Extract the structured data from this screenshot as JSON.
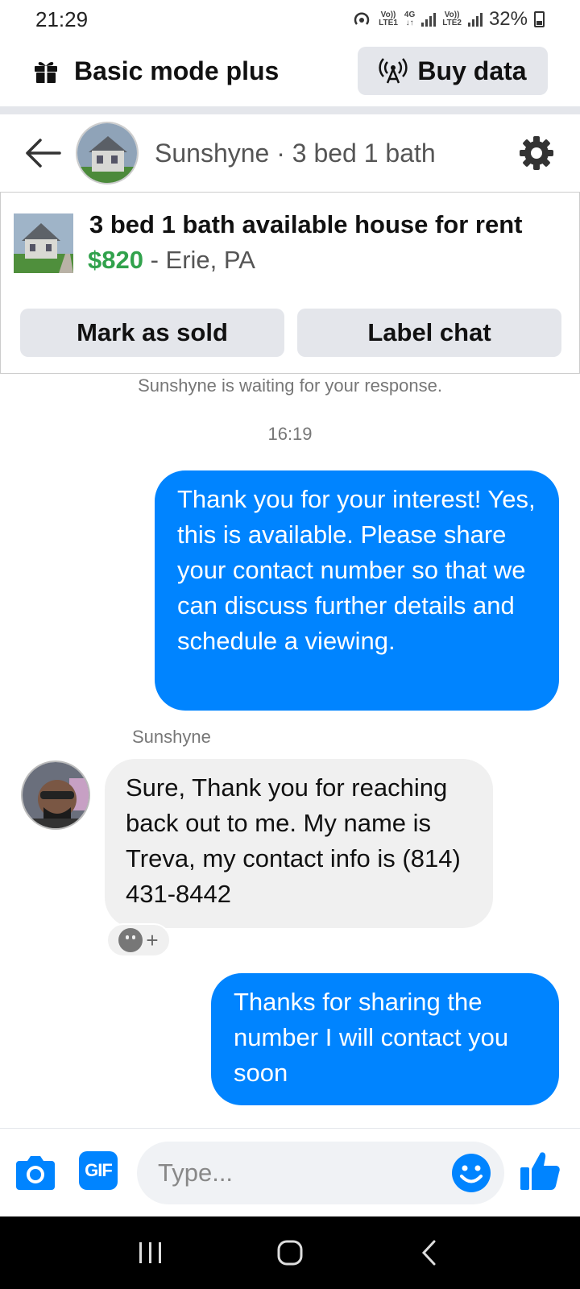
{
  "status": {
    "time": "21:29",
    "sim1": {
      "top": "Vo))",
      "bottom": "LTE1"
    },
    "network": {
      "top": "4G",
      "bottom": "↓↑"
    },
    "sim2": {
      "top": "Vo))",
      "bottom": "LTE2"
    },
    "battery": "32%"
  },
  "mode_bar": {
    "title": "Basic mode plus",
    "buy_data_label": "Buy data"
  },
  "chat_header": {
    "title": "Sunshyne · 3 bed 1 bath"
  },
  "listing": {
    "title": "3 bed 1 bath available house for rent",
    "price": "$820",
    "location": " - Erie, PA",
    "mark_sold_label": "Mark as sold",
    "label_chat_label": "Label chat"
  },
  "chat": {
    "waiting_notice": "Sunshyne is waiting for your response.",
    "timestamp": "16:19",
    "messages": [
      {
        "from": "me",
        "text": "Thank you for your interest! Yes, this is available. Please share your contact number so that we can discuss further details and schedule a viewing."
      },
      {
        "from": "Sunshyne",
        "sender_name": "Sunshyne",
        "text": "Sure, Thank you for reaching back out to me. My name is Treva, my  contact info is (814) 431-8442"
      },
      {
        "from": "me",
        "text": "Thanks for sharing the number I will contact you soon"
      }
    ],
    "reaction_add": "+"
  },
  "composer": {
    "gif_label": "GIF",
    "placeholder": "Type..."
  },
  "colors": {
    "accent": "#0084ff",
    "price_green": "#31a24c",
    "button_gray": "#e4e6eb",
    "incoming_bubble": "#f0f0f0"
  },
  "icons": {
    "gift": "gift-icon",
    "antenna": "antenna-icon",
    "back": "back-arrow-icon",
    "settings": "gear-icon",
    "camera": "camera-icon",
    "emoji": "emoji-icon",
    "like": "thumbs-up-icon"
  }
}
